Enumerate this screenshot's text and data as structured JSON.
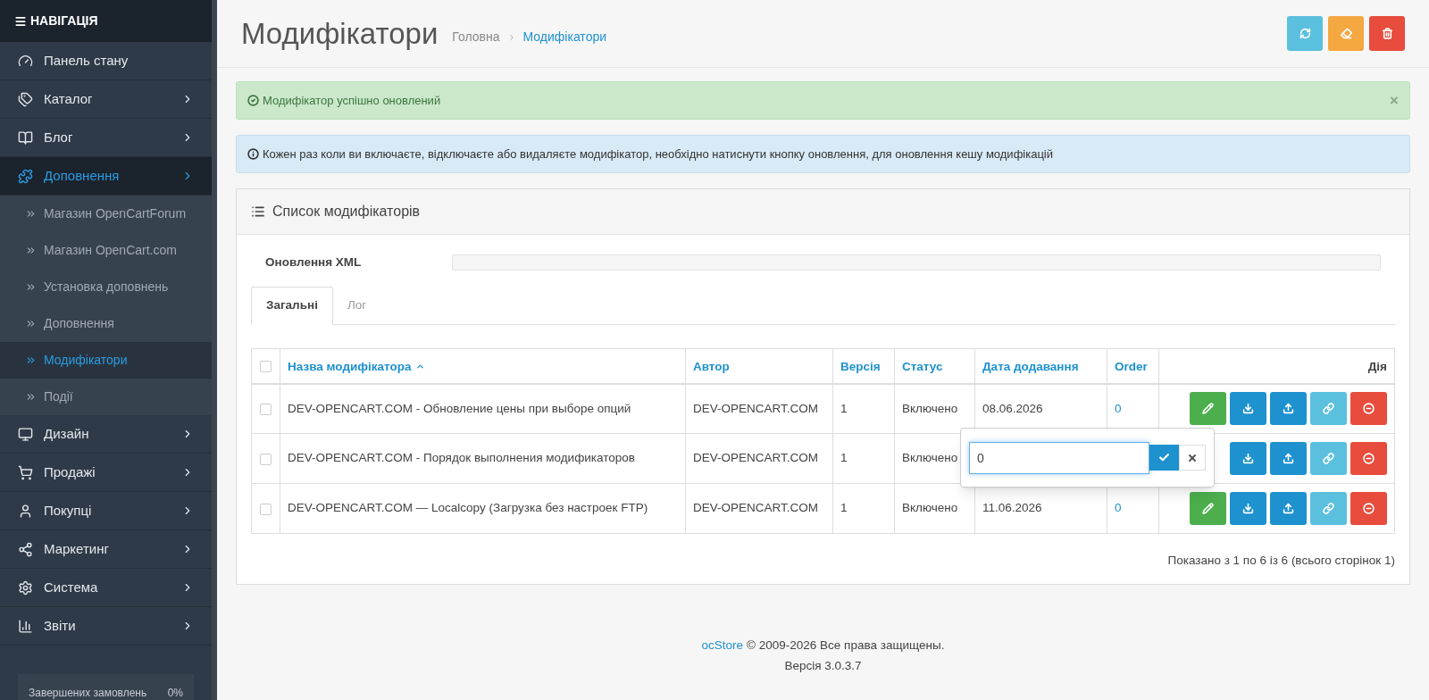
{
  "sidebar": {
    "title": "НАВІГАЦІЯ",
    "items": [
      {
        "label": "Панель стану",
        "kind": "dashboard",
        "selected": false
      },
      {
        "label": "Каталог",
        "kind": "tags",
        "selected": false
      },
      {
        "label": "Блог",
        "kind": "book",
        "selected": false
      },
      {
        "label": "Доповнення",
        "kind": "puzzle",
        "selected": true,
        "children": [
          {
            "label": "Магазин OpenCartForum",
            "selected": false
          },
          {
            "label": "Магазин OpenCart.com",
            "selected": false
          },
          {
            "label": "Установка доповнень",
            "selected": false
          },
          {
            "label": "Доповнення",
            "selected": false
          },
          {
            "label": "Модифікатори",
            "selected": true
          },
          {
            "label": "Події",
            "selected": false
          }
        ]
      },
      {
        "label": "Дизайн",
        "kind": "monitor",
        "selected": false
      },
      {
        "label": "Продажі",
        "kind": "cart",
        "selected": false
      },
      {
        "label": "Покупці",
        "kind": "user",
        "selected": false
      },
      {
        "label": "Маркетинг",
        "kind": "share",
        "selected": false
      },
      {
        "label": "Система",
        "kind": "gear",
        "selected": false
      },
      {
        "label": "Звіти",
        "kind": "chart",
        "selected": false
      }
    ],
    "stat": {
      "label": "Завершених замовлень",
      "value": "0%"
    }
  },
  "header": {
    "title": "Модифікатори",
    "breadcrumbs": [
      {
        "label": "Головна",
        "selected": false
      },
      {
        "label": "Модифікатори",
        "selected": true
      }
    ],
    "buttons": [
      {
        "kind": "refresh"
      },
      {
        "kind": "clear"
      },
      {
        "kind": "delete"
      }
    ]
  },
  "alerts": [
    {
      "kind": "success",
      "text": "Модифікатор успішно оновлений",
      "close": "×"
    },
    {
      "kind": "info",
      "text": "Кожен раз коли ви включаєте, відключаєте або видаляєте модифікатор, необхідно натиснути кнопку оновлення, для оновлення кешу модифікацій"
    }
  ],
  "panel": {
    "title": "Список модифікаторів",
    "xml_update": {
      "label": "Оновлення XML",
      "level": 0
    },
    "tabs": [
      {
        "label": "Загальні",
        "selected": true
      },
      {
        "label": "Лог",
        "selected": false
      }
    ],
    "table": {
      "columns": [
        {
          "label": "Назва модифікатора",
          "kind": "sorted-asc"
        },
        {
          "label": "Автор",
          "kind": "sortable"
        },
        {
          "label": "Версія",
          "kind": "sortable"
        },
        {
          "label": "Статус",
          "kind": "sortable"
        },
        {
          "label": "Дата додавання",
          "kind": "sortable"
        },
        {
          "label": "Order",
          "kind": "sortable"
        },
        {
          "label": "Дія",
          "kind": "plain"
        }
      ],
      "header_checked": false,
      "rows": [
        {
          "checked": false,
          "name": "DEV-OPENCART.COM - Обновление цены при выборе опций",
          "author": "DEV-OPENCART.COM",
          "version": "1",
          "status": "Включено",
          "date": "08.06.2026",
          "order": "0",
          "actions": [
            {
              "kind": "edit"
            },
            {
              "kind": "download"
            },
            {
              "kind": "upload"
            },
            {
              "kind": "link"
            },
            {
              "kind": "remove"
            }
          ]
        },
        {
          "checked": false,
          "name": "DEV-OPENCART.COM - Порядок выполнения модификаторов",
          "author": "DEV-OPENCART.COM",
          "version": "1",
          "status": "Включено",
          "actions": [
            {
              "kind": "download"
            },
            {
              "kind": "upload"
            },
            {
              "kind": "link"
            },
            {
              "kind": "remove"
            }
          ]
        },
        {
          "checked": false,
          "name": "DEV-OPENCART.COM — Localcopy (Загрузка без настроек FTP)",
          "author": "DEV-OPENCART.COM",
          "version": "1",
          "status": "Включено",
          "date": "11.06.2026",
          "order": "0",
          "actions": [
            {
              "kind": "edit"
            },
            {
              "kind": "download"
            },
            {
              "kind": "upload"
            },
            {
              "kind": "link"
            },
            {
              "kind": "remove"
            }
          ]
        }
      ]
    },
    "popover": {
      "value": "0"
    },
    "pagination": "Показано з 1 по 6 із 6 (всього сторінок 1)"
  },
  "footer": {
    "link": "ocStore",
    "text": "© 2009-2026 Все права защищены.",
    "version": "Версія 3.0.3.7"
  }
}
